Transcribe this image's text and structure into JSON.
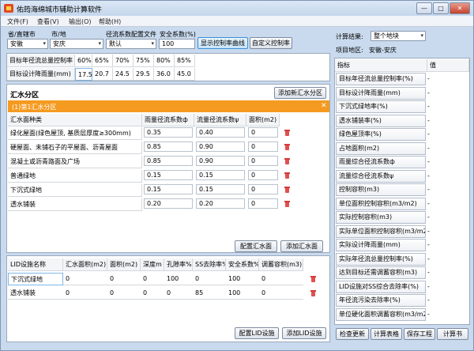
{
  "window": {
    "title": "佑筠海绵城市辅助计算软件",
    "min": "—",
    "max": "□",
    "close": "✕"
  },
  "menu": [
    "文件(F)",
    "查看(V)",
    "输出(O)",
    "帮助(H)"
  ],
  "top": {
    "province_label": "省/直辖市",
    "city_label": "市/地",
    "config_label": "径流系数配置文件",
    "safety_label": "安全系数(%)",
    "province": "安徽",
    "city": "安庆",
    "config": "默认",
    "safety": "100",
    "btn_curve": "显示控制率曲线",
    "btn_custom": "自定义控制率"
  },
  "target": {
    "rate_label": "目标年径流总量控制率",
    "rain_label": "目标设计降雨量(mm)",
    "rates": [
      "60%",
      "65%",
      "70%",
      "75%",
      "80%",
      "85%"
    ],
    "rains": [
      "17.5",
      "20.7",
      "24.5",
      "29.5",
      "36.0",
      "45.0"
    ]
  },
  "catchment": {
    "title": "汇水分区",
    "add_btn": "添加新汇水分区",
    "zone_title": "(1)第1汇水分区",
    "zone_close": "✕",
    "headers": [
      "汇水面种类",
      "雨量径流系数ф",
      "流量径流系数ψ",
      "面积(m2)"
    ],
    "rows": [
      [
        "绿化屋面(绿色屋顶, 基质层厚度≥300mm)",
        "0.35",
        "0.40",
        "0"
      ],
      [
        "硬屋面、未铺石子的平屋面、沥青屋面",
        "0.85",
        "0.90",
        "0"
      ],
      [
        "混凝土或沥青路面及广场",
        "0.85",
        "0.90",
        "0"
      ],
      [
        "普通绿地",
        "0.15",
        "0.15",
        "0"
      ],
      [
        "下沉式绿地",
        "0.15",
        "0.15",
        "0"
      ],
      [
        "透水铺装",
        "0.20",
        "0.20",
        "0"
      ]
    ],
    "btn_config": "配置汇水面",
    "btn_add": "添加汇水面"
  },
  "lid": {
    "headers": [
      "LID设施名称",
      "汇水面积(m2)",
      "面积(m2)",
      "深度m",
      "孔隙率%",
      "SS去除率%",
      "安全系数%",
      "调蓄容积(m3)"
    ],
    "rows": [
      [
        "下沉式绿地",
        "0",
        "0",
        "0",
        "100",
        "0",
        "100",
        "0"
      ],
      [
        "透水铺装",
        "0",
        "0",
        "0",
        "0",
        "85",
        "100",
        "0"
      ]
    ],
    "btn_config": "配置LID设施",
    "btn_add": "添加LID设施"
  },
  "result": {
    "label": "计算结果:",
    "select": "整个地块",
    "area_label": "项目地区:",
    "area": "安徽-安庆",
    "header_name": "指标",
    "header_val": "值",
    "items": [
      "目标年径流总量控制率(%)",
      "目标设计降雨量(mm)",
      "下沉式绿地率(%)",
      "透水铺装率(%)",
      "绿色屋顶率(%)",
      "占地面积(m2)",
      "雨量综合径流系数ф",
      "流量综合径流系数ψ",
      "控制容积(m3)",
      "单位面积控制容积(m3/m2)",
      "实际控制容积(m3)",
      "实际单位面积控制容积(m3/m2)",
      "实际设计降雨量(mm)",
      "实际年径流总量控制率(%)",
      "达到目标还需调蓄容积(m3)",
      "LID设施对SS综合去除率(%)",
      "年径流污染去除率(%)",
      "单位硬化面积调蓄容积(m3/m2)"
    ],
    "values": [
      "-",
      "-",
      "-",
      "-",
      "-",
      "-",
      "-",
      "-",
      "-",
      "-",
      "-",
      "-",
      "-",
      "-",
      "-",
      "-",
      "-",
      "-"
    ],
    "btns": [
      "检查更新",
      "计算表格",
      "保存工程",
      "计算书"
    ]
  }
}
